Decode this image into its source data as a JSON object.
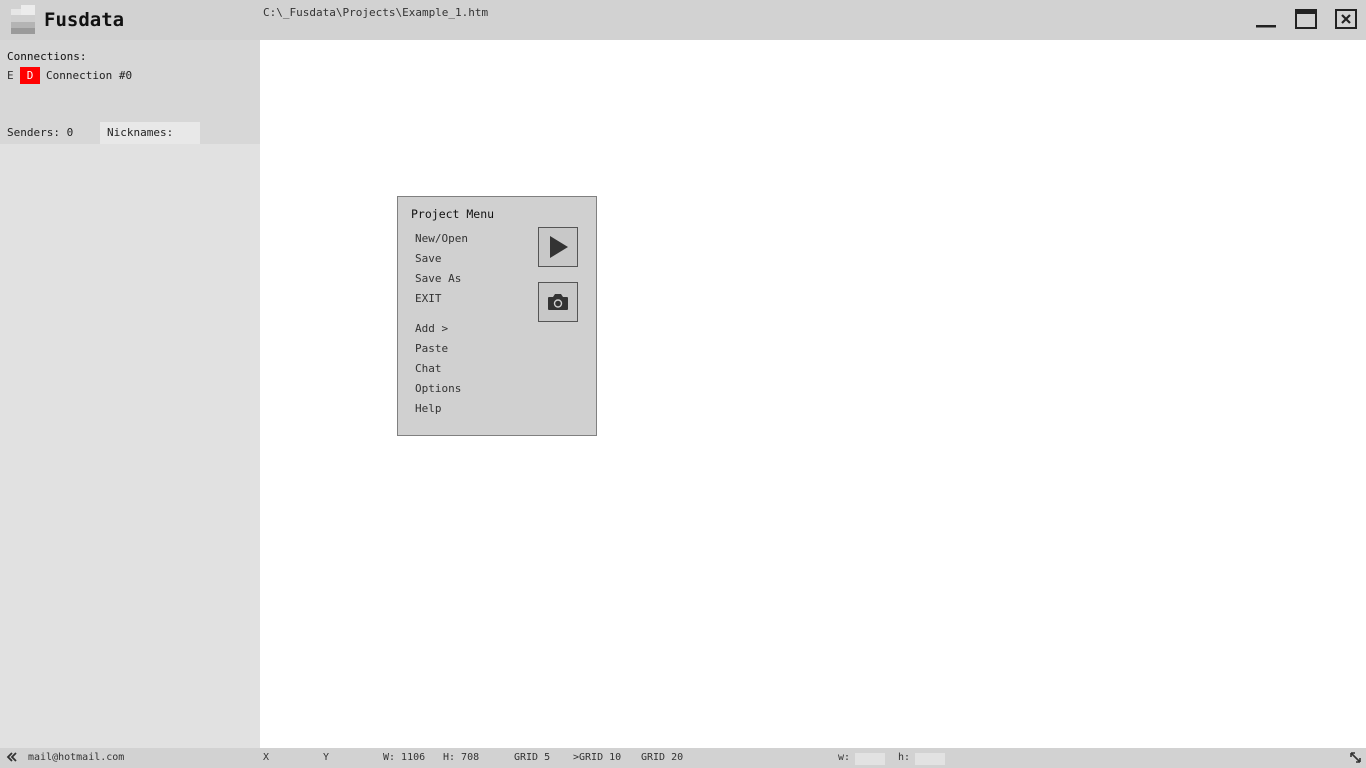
{
  "app": {
    "title": "Fusdata",
    "file_path": "C:\\_Fusdata\\Projects\\Example_1.htm"
  },
  "window_controls": [
    "minimize-icon",
    "maximize-icon",
    "close-icon"
  ],
  "sidebar": {
    "connections_label": "Connections:",
    "connection": {
      "e_label": "E",
      "d_label": "D",
      "name": "Connection #0",
      "d_color": "#ff0000"
    },
    "senders_label": "Senders: 0",
    "nicknames_label": "Nicknames:"
  },
  "project_menu": {
    "title": "Project Menu",
    "items": [
      "New/Open",
      "Save",
      "Save As",
      "EXIT",
      "Add >",
      "Paste",
      "Chat",
      "Options",
      "Help"
    ],
    "buttons": [
      "play-icon",
      "camera-icon"
    ]
  },
  "statusbar": {
    "collapse_icon": "double-chevron-left-icon",
    "email": "mail@hotmail.com",
    "x_label": "X",
    "y_label": "Y",
    "w_readout": "W: 1106",
    "h_readout": "H: 708",
    "grid5": "GRID 5",
    "grid10": ">GRID 10",
    "grid20": "GRID 20",
    "w_label": "w:",
    "h_label": "h:",
    "w_value": "",
    "h_value": "",
    "resize_icon": "resize-diagonal-icon"
  }
}
